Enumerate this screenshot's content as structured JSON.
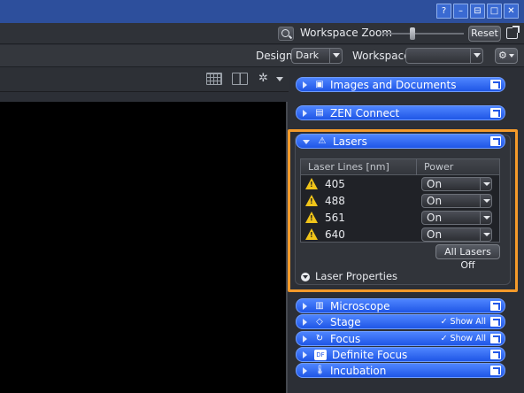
{
  "window": {
    "buttons": [
      "?",
      "–",
      "⊟",
      "□",
      "✕"
    ]
  },
  "zoom": {
    "label": "Workspace Zoom",
    "reset_label": "Reset"
  },
  "design": {
    "design_label": "Design",
    "design_value": "Dark",
    "workspace_label": "Workspace",
    "workspace_value": "",
    "gear_glyph": "⚙"
  },
  "viewer": {
    "gear_glyph": "✲"
  },
  "tools": {
    "images_documents": {
      "label": "Images and Documents",
      "icon": "images-icon"
    },
    "zen_connect": {
      "label": "ZEN Connect",
      "icon": "zen-connect-icon"
    },
    "lasers": {
      "label": "Lasers",
      "icon": "laser-icon"
    },
    "microscope": {
      "label": "Microscope",
      "icon": "microscope-icon"
    },
    "stage": {
      "label": "Stage",
      "icon": "stage-icon",
      "show_all": "✓ Show All"
    },
    "focus": {
      "label": "Focus",
      "icon": "focus-icon",
      "show_all": "✓ Show All"
    },
    "definite_focus": {
      "label": "Definite Focus",
      "icon": "definite-focus-icon"
    },
    "incubation": {
      "label": "Incubation",
      "icon": "thermometer-icon"
    }
  },
  "lasers_panel": {
    "columns": [
      "Laser Lines [nm]",
      "Power"
    ],
    "rows": [
      {
        "wavelength": "405",
        "power": "On"
      },
      {
        "wavelength": "488",
        "power": "On"
      },
      {
        "wavelength": "561",
        "power": "On"
      },
      {
        "wavelength": "640",
        "power": "On"
      }
    ],
    "all_off_label": "All Lasers Off",
    "properties_label": "Laser Properties"
  },
  "colors": {
    "tool_header_blue": "#2f68f5",
    "highlight_orange": "#f49a2a",
    "warning_yellow": "#f0c419",
    "titlebar_blue": "#2d4f9c"
  }
}
